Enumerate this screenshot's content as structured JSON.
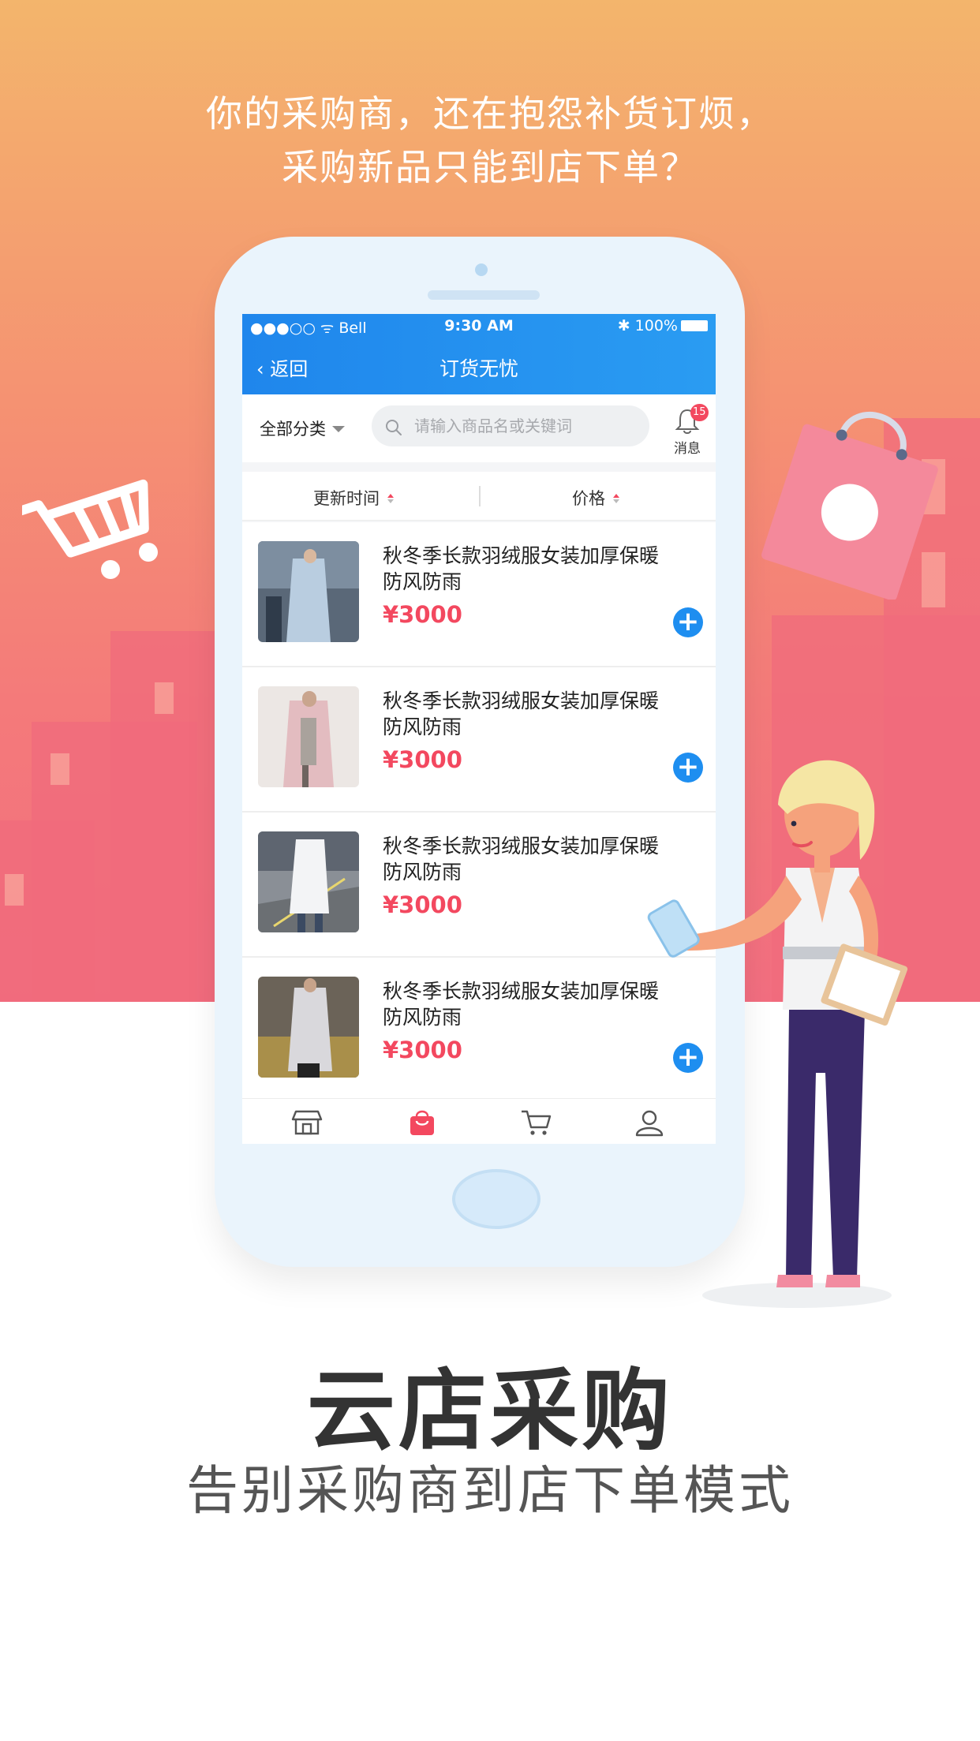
{
  "promo": {
    "tagline_line1": "你的采购商，还在抱怨补货订烦，",
    "tagline_line2": "采购新品只能到店下单？",
    "headline": "云店采购",
    "subheadline": "告别采购商到店下单模式"
  },
  "status_bar": {
    "carrier": "●●●○○ ᯤ Bell",
    "time": "9:30 AM",
    "battery": "100%"
  },
  "nav": {
    "back_label": "返回",
    "title": "订货无忧"
  },
  "search": {
    "category_label": "全部分类",
    "placeholder": "请输入商品名或关键词",
    "message_label": "消息",
    "message_count": "15"
  },
  "sort": {
    "update_time_label": "更新时间",
    "price_label": "价格"
  },
  "products": [
    {
      "name": "秋冬季长款羽绒服女装加厚保暖防风防雨",
      "price": "¥3000",
      "image": "light-blue-down-coat"
    },
    {
      "name": "秋冬季长款羽绒服女装加厚保暖防风防雨",
      "price": "¥3000",
      "image": "pink-down-coat"
    },
    {
      "name": "秋冬季长款羽绒服女装加厚保暖防风防雨",
      "price": "¥3000",
      "image": "white-down-coat"
    },
    {
      "name": "秋冬季长款羽绒服女装加厚保暖防风防雨",
      "price": "¥3000",
      "image": "grey-down-coat"
    }
  ],
  "tabbar": {
    "icons": [
      "store-icon",
      "bag-icon",
      "cart-icon",
      "user-icon"
    ],
    "active_index": 1
  },
  "colors": {
    "accent_blue": "#1e8ef0",
    "price_red": "#f3485f",
    "background_orange": "#f59272"
  }
}
